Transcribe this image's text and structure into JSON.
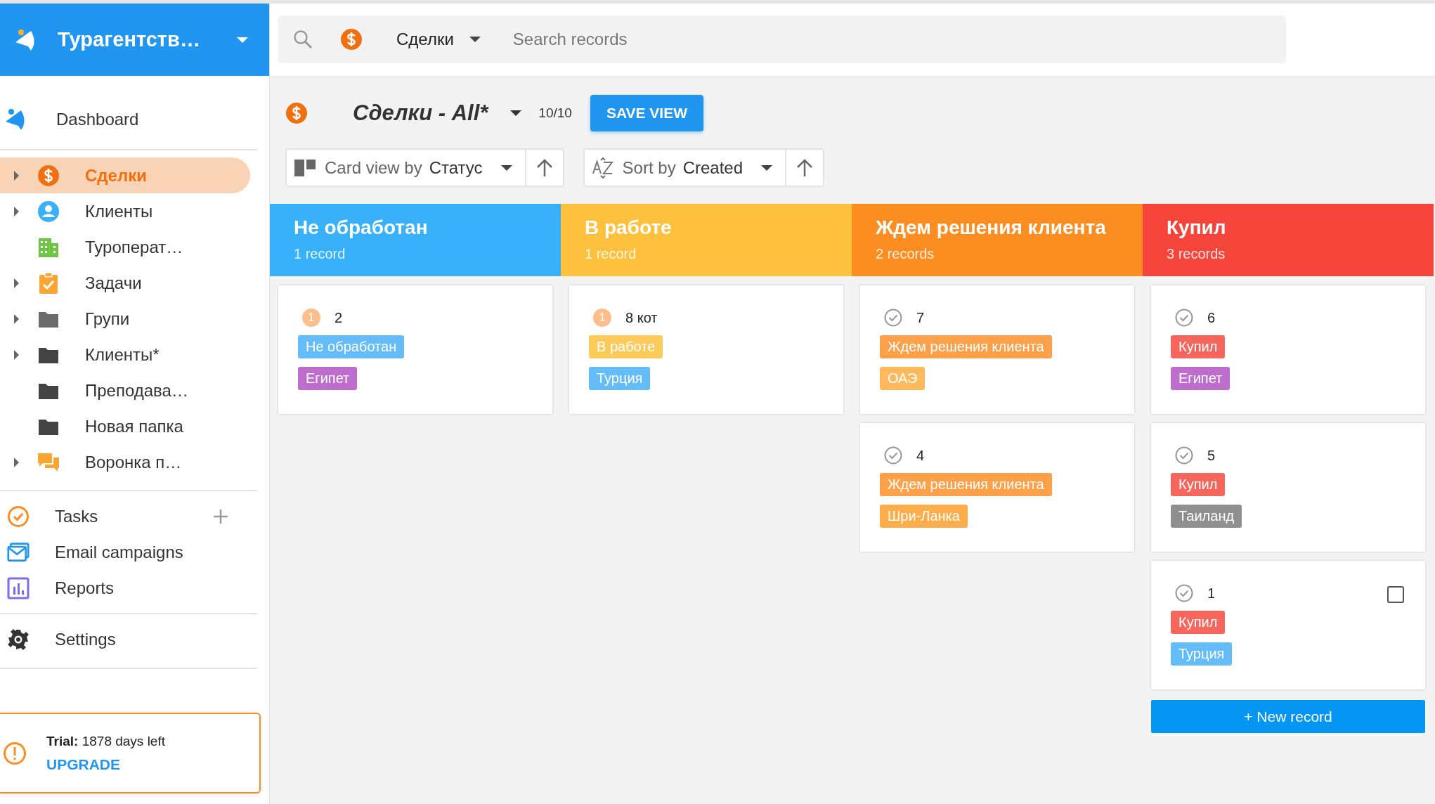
{
  "workspace": {
    "title": "Турагентств…"
  },
  "sidebar": {
    "top_item": {
      "label": "Dashboard"
    },
    "items": [
      {
        "label": "Сделки",
        "expandable": true,
        "selected": true
      },
      {
        "label": "Клиенты",
        "expandable": true,
        "selected": false
      },
      {
        "label": "Туроперат…",
        "expandable": false,
        "selected": false
      },
      {
        "label": "Задачи",
        "expandable": true,
        "selected": false
      },
      {
        "label": "Групи",
        "expandable": true,
        "selected": false
      },
      {
        "label": "Клиенты*",
        "expandable": true,
        "selected": false
      },
      {
        "label": "Преподава…",
        "expandable": false,
        "selected": false
      },
      {
        "label": "Новая папка",
        "expandable": false,
        "selected": false
      },
      {
        "label": "Воронка п…",
        "expandable": true,
        "selected": false
      }
    ],
    "tools": [
      {
        "label": "Tasks",
        "add": true
      },
      {
        "label": "Email campaigns",
        "add": false
      },
      {
        "label": "Reports",
        "add": false
      }
    ],
    "settings": {
      "label": "Settings"
    },
    "trial": {
      "text": "**Trial:** 1878 days left",
      "link": "UPGRADE"
    }
  },
  "search": {
    "entity": "Сделки",
    "placeholder": "Search records"
  },
  "view": {
    "title": "Сделки - All*",
    "count": "10/10",
    "save_button": "SAVE VIEW",
    "card_view": {
      "label": "Card view by",
      "value": "Статус"
    },
    "sort": {
      "label": "Sort by",
      "value": "Created"
    }
  },
  "board": {
    "columns": [
      {
        "title": "Не обработан",
        "count": "1 record",
        "color": "#38b0fa",
        "cards": [
          {
            "kind": "priority",
            "badge": "1",
            "title": "2",
            "tags": [
              {
                "label": "Не обработан",
                "color": "#64bdf8"
              },
              {
                "label": "Египет",
                "color": "#bd6ecc"
              }
            ]
          }
        ]
      },
      {
        "title": "В работе",
        "count": "1 record",
        "color": "#fdc13d",
        "cards": [
          {
            "kind": "priority",
            "badge": "1",
            "title": "8 кот",
            "tags": [
              {
                "label": "В работе",
                "color": "#fdcb5a"
              },
              {
                "label": "Турция",
                "color": "#64bdf8"
              }
            ]
          }
        ]
      },
      {
        "title": "Ждем решения клиента",
        "count": "2 records",
        "color": "#fc8e21",
        "cards": [
          {
            "kind": "done",
            "title": "7",
            "tags": [
              {
                "label": "Ждем решения клиента",
                "color": "#fca04a"
              },
              {
                "label": "ОАЭ",
                "color": "#fdb95c"
              }
            ]
          },
          {
            "kind": "done",
            "title": "4",
            "tags": [
              {
                "label": "Ждем решения клиента",
                "color": "#fca04a"
              },
              {
                "label": "Шри-Ланка",
                "color": "#fdad4a"
              }
            ]
          }
        ]
      },
      {
        "title": "Купил",
        "count": "3 records",
        "color": "#f5453b",
        "cards": [
          {
            "kind": "done",
            "title": "6",
            "tags": [
              {
                "label": "Купил",
                "color": "#f6665d"
              },
              {
                "label": "Египет",
                "color": "#bd6ecc"
              }
            ]
          },
          {
            "kind": "done",
            "title": "5",
            "tags": [
              {
                "label": "Купил",
                "color": "#f6665d"
              },
              {
                "label": "Таиланд",
                "color": "#8f8f8f"
              }
            ]
          },
          {
            "kind": "done",
            "title": "1",
            "checked": false,
            "tags": [
              {
                "label": "Купил",
                "color": "#f6665d"
              },
              {
                "label": "Турция",
                "color": "#64bdf8"
              }
            ]
          }
        ],
        "new_record": "+ New record"
      }
    ]
  }
}
